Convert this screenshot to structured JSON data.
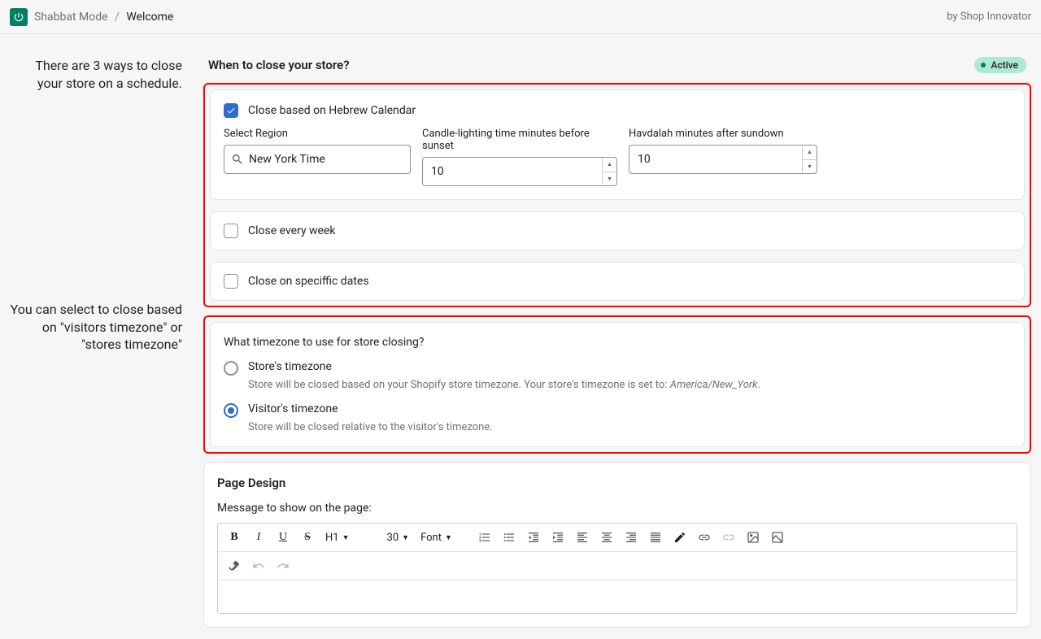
{
  "header": {
    "app_name": "Shabbat Mode",
    "page": "Welcome",
    "by": "by Shop Innovator"
  },
  "callouts": {
    "schedule": "There are 3 ways to close your store on a schedule.",
    "timezone": "You can select to close based on \"visitors timezone\" or \"stores timezone\""
  },
  "section_title": "When to close your store?",
  "status_badge": "Active",
  "options": {
    "hebrew": {
      "label": "Close based on Hebrew Calendar",
      "checked": true,
      "region_label": "Select Region",
      "region_value": "New York Time",
      "candle_label": "Candle-lighting time minutes before sunset",
      "candle_value": "10",
      "havdalah_label": "Havdalah minutes after sundown",
      "havdalah_value": "10"
    },
    "weekly": {
      "label": "Close every week",
      "checked": false
    },
    "specific": {
      "label": "Close on speciffic dates",
      "checked": false
    }
  },
  "timezone": {
    "question": "What timezone to use for store closing?",
    "store": {
      "label": "Store's timezone",
      "desc_prefix": "Store will be closed based on your Shopify store timezone. Your store's timezone is set to: ",
      "desc_tz": "America/New_York",
      "desc_suffix": ".",
      "selected": false
    },
    "visitor": {
      "label": "Visitor's timezone",
      "desc": "Store will be closed relative to the visitor's timezone.",
      "selected": true
    }
  },
  "page_design": {
    "title": "Page Design",
    "subtitle": "Message to show on the page:",
    "toolbar": {
      "heading": "H1",
      "size": "30",
      "font": "Font"
    }
  }
}
